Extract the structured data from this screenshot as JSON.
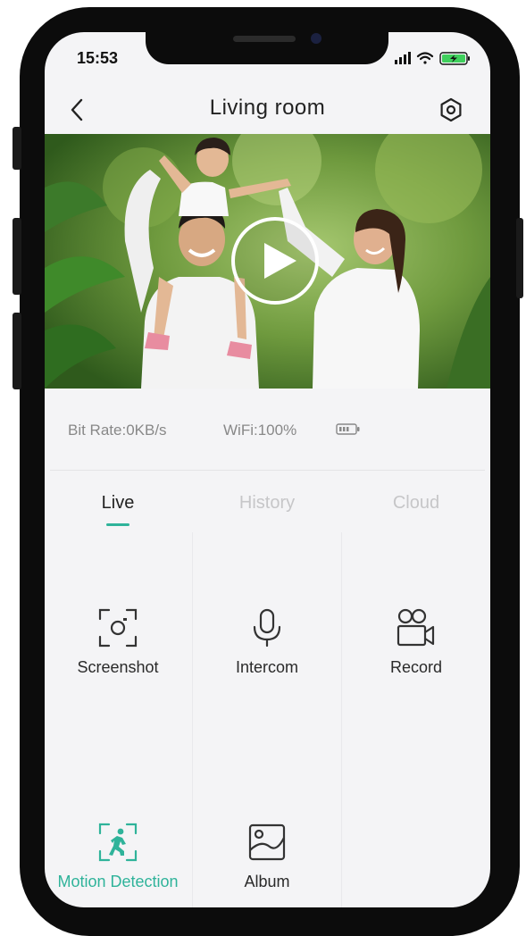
{
  "status_bar": {
    "time": "15:53"
  },
  "header": {
    "title": "Living room"
  },
  "stats": {
    "bit_rate": "Bit Rate:0KB/s",
    "wifi": "WiFi:100%"
  },
  "tabs": [
    {
      "label": "Live",
      "active": true
    },
    {
      "label": "History",
      "active": false
    },
    {
      "label": "Cloud",
      "active": false
    }
  ],
  "actions": [
    {
      "label": "Screenshot",
      "icon": "screenshot-icon"
    },
    {
      "label": "Intercom",
      "icon": "microphone-icon"
    },
    {
      "label": "Record",
      "icon": "video-camera-icon"
    },
    {
      "label": "Motion Detection",
      "icon": "motion-detection-icon"
    },
    {
      "label": "Album",
      "icon": "album-icon"
    }
  ],
  "colors": {
    "accent": "#2fb39a",
    "text": "#222222",
    "muted": "#888888",
    "inactive_tab": "#c6c6c8"
  }
}
